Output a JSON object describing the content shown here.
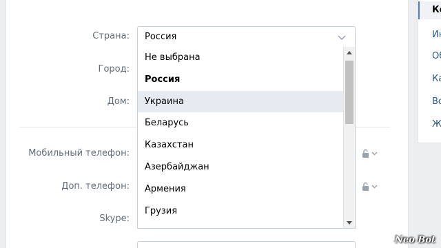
{
  "form": {
    "country_label": "Страна:",
    "city_label": "Город:",
    "house_label": "Дом:",
    "mobile_label": "Мобильный телефон:",
    "extra_phone_label": "Доп. телефон:",
    "skype_label": "Skype:"
  },
  "country_select": {
    "value": "Россия",
    "options": [
      "Не выбрана",
      "Россия",
      "Украина",
      "Беларусь",
      "Казахстан",
      "Азербайджан",
      "Армения",
      "Грузия"
    ],
    "bold_option": "Россия",
    "hover_option": "Украина"
  },
  "right_menu": {
    "items": [
      "Ко",
      "Ин",
      "Об",
      "Ка",
      "Во",
      "Ж"
    ],
    "active": "Ко"
  },
  "watermark": "Neo Bot",
  "colors": {
    "page_bg": "#edeef0",
    "link": "#2a5885",
    "label": "#626d7a",
    "hover": "#e5ebf1",
    "border": "#c5d0db"
  }
}
